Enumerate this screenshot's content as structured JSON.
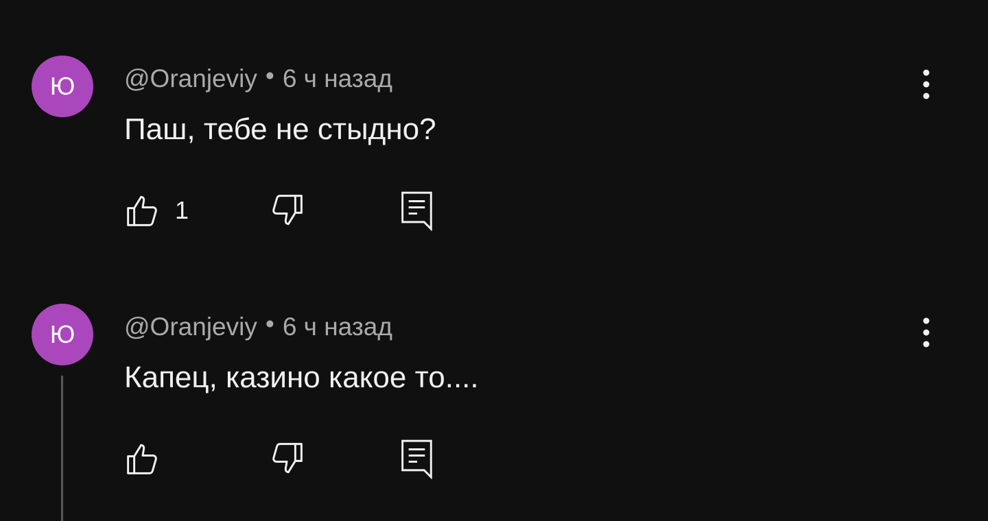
{
  "comments": [
    {
      "avatar_letter": "Ю",
      "avatar_color": "#ab47bc",
      "author": "@Oranjeviy",
      "separator": "•",
      "time": "6 ч назад",
      "text": "Паш, тебе не стыдно?",
      "likes": "1",
      "icons": {
        "like": "thumb-up-icon",
        "dislike": "thumb-down-icon",
        "reply": "reply-icon",
        "more": "more-vert-icon"
      }
    },
    {
      "avatar_letter": "Ю",
      "avatar_color": "#ab47bc",
      "author": "@Oranjeviy",
      "separator": "•",
      "time": "6 ч назад",
      "text": "Капец, казино какое то....",
      "likes": "",
      "icons": {
        "like": "thumb-up-icon",
        "dislike": "thumb-down-icon",
        "reply": "reply-icon",
        "more": "more-vert-icon"
      }
    }
  ]
}
